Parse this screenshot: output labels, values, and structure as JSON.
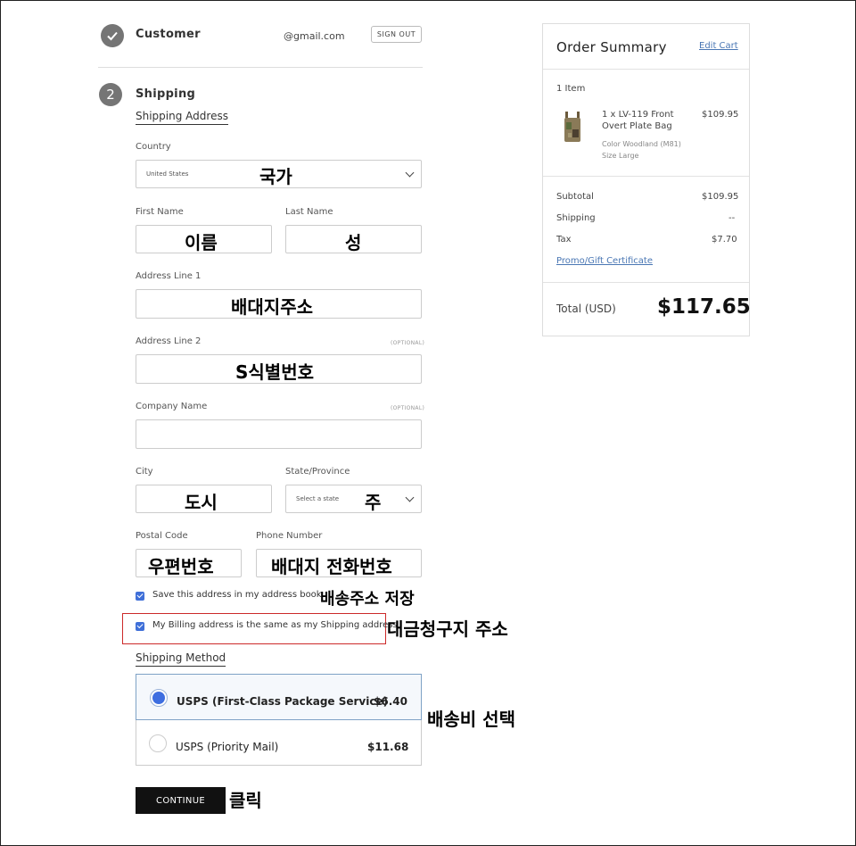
{
  "customer": {
    "step_title": "Customer",
    "email": "@gmail.com",
    "sign_out": "SIGN OUT"
  },
  "shipping": {
    "step_number": "2",
    "step_title": "Shipping",
    "address_heading": "Shipping Address",
    "fields": {
      "country_label": "Country",
      "country_value": "United States",
      "first_name_label": "First Name",
      "last_name_label": "Last Name",
      "address1_label": "Address Line 1",
      "address2_label": "Address Line 2",
      "optional": "(OPTIONAL)",
      "company_label": "Company Name",
      "city_label": "City",
      "state_label": "State/Province",
      "state_placeholder": "Select a state",
      "postal_label": "Postal Code",
      "phone_label": "Phone Number"
    },
    "save_address_label": "Save this address in my address book.",
    "billing_same_label": "My Billing address is the same as my Shipping address",
    "method_heading": "Shipping Method",
    "methods": [
      {
        "name": "USPS (First-Class Package Service)",
        "price": "$6.40",
        "selected": true
      },
      {
        "name": "USPS (Priority Mail)",
        "price": "$11.68",
        "selected": false
      }
    ],
    "continue": "CONTINUE"
  },
  "annotations": {
    "country": "국가",
    "first_name": "이름",
    "last_name": "성",
    "address1": "배대지주소",
    "address2": "S식별번호",
    "city": "도시",
    "state": "주",
    "postal": "우편번호",
    "phone": "배대지 전화번호",
    "save_address": "배송주소 저장",
    "billing": "대금청구지 주소",
    "shipping_fee": "배송비 선택",
    "click": "클릭"
  },
  "summary": {
    "title": "Order Summary",
    "edit_cart": "Edit Cart",
    "item_count": "1 Item",
    "item": {
      "name": "1 x LV-119 Front Overt Plate Bag",
      "price": "$109.95",
      "color": "Color Woodland (M81)",
      "size": "Size Large"
    },
    "subtotal_label": "Subtotal",
    "subtotal_value": "$109.95",
    "shipping_label": "Shipping",
    "shipping_value": "--",
    "tax_label": "Tax",
    "tax_value": "$7.70",
    "promo": "Promo/Gift Certificate",
    "total_label": "Total (USD)",
    "total_value": "$117.65"
  },
  "colors": {
    "accent": "#3e6ee0",
    "link": "#4a77b4",
    "annotation_box": "#cc2a2a",
    "button": "#111111"
  }
}
